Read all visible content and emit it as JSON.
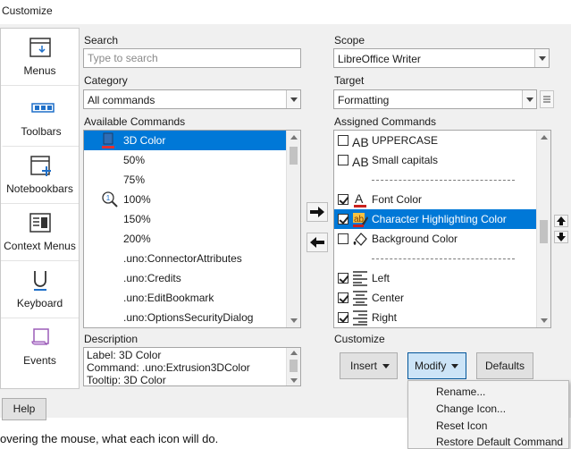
{
  "window": {
    "title": "Customize"
  },
  "sidebar": {
    "items": [
      {
        "label": "Menus",
        "icon": "menus-icon"
      },
      {
        "label": "Toolbars",
        "icon": "toolbars-icon",
        "selected": true
      },
      {
        "label": "Notebookbars",
        "icon": "notebookbars-icon"
      },
      {
        "label": "Context Menus",
        "icon": "context-menus-icon"
      },
      {
        "label": "Keyboard",
        "icon": "keyboard-icon"
      },
      {
        "label": "Events",
        "icon": "events-icon"
      }
    ]
  },
  "search": {
    "label": "Search",
    "placeholder": "Type to search"
  },
  "category": {
    "label": "Category",
    "value": "All commands"
  },
  "available": {
    "label": "Available Commands",
    "items": [
      "3D Color",
      "50%",
      "75%",
      "100%",
      "150%",
      "200%",
      ".uno:ConnectorAttributes",
      ".uno:Credits",
      ".uno:EditBookmark",
      ".uno:OptionsSecurityDialog"
    ]
  },
  "description": {
    "label": "Description",
    "lines": [
      "Label: 3D Color",
      "Command: .uno:Extrusion3DColor",
      "Tooltip: 3D Color"
    ]
  },
  "scope": {
    "label": "Scope",
    "value": "LibreOffice Writer"
  },
  "target": {
    "label": "Target",
    "value": "Formatting"
  },
  "assigned": {
    "label": "Assigned Commands",
    "items": [
      {
        "label": "UPPERCASE",
        "checked": false,
        "icon": "uppercase-icon"
      },
      {
        "label": "Small capitals",
        "checked": false,
        "icon": "small-capitals-icon"
      },
      {
        "separator": true
      },
      {
        "label": "Font Color",
        "checked": true,
        "icon": "font-color-icon"
      },
      {
        "label": "Character Highlighting Color",
        "checked": true,
        "icon": "highlighting-icon",
        "selected": true
      },
      {
        "label": "Background Color",
        "checked": false,
        "icon": "background-color-icon"
      },
      {
        "separator": true
      },
      {
        "label": "Left",
        "checked": true,
        "icon": "align-left-icon"
      },
      {
        "label": "Center",
        "checked": true,
        "icon": "align-center-icon"
      },
      {
        "label": "Right",
        "checked": true,
        "icon": "align-right-icon"
      }
    ]
  },
  "customize": {
    "label": "Customize",
    "insert_label": "Insert",
    "modify_label": "Modify",
    "defaults_label": "Defaults"
  },
  "modify_menu": {
    "items": [
      "Rename...",
      "Change Icon...",
      "Reset Icon",
      "Restore Default Command"
    ]
  },
  "footer": {
    "help_label": "Help",
    "background_text": [
      "overing the mouse, what each icon will do."
    ]
  },
  "colors": {
    "selection": "#0078d7",
    "accent": "#005499"
  }
}
